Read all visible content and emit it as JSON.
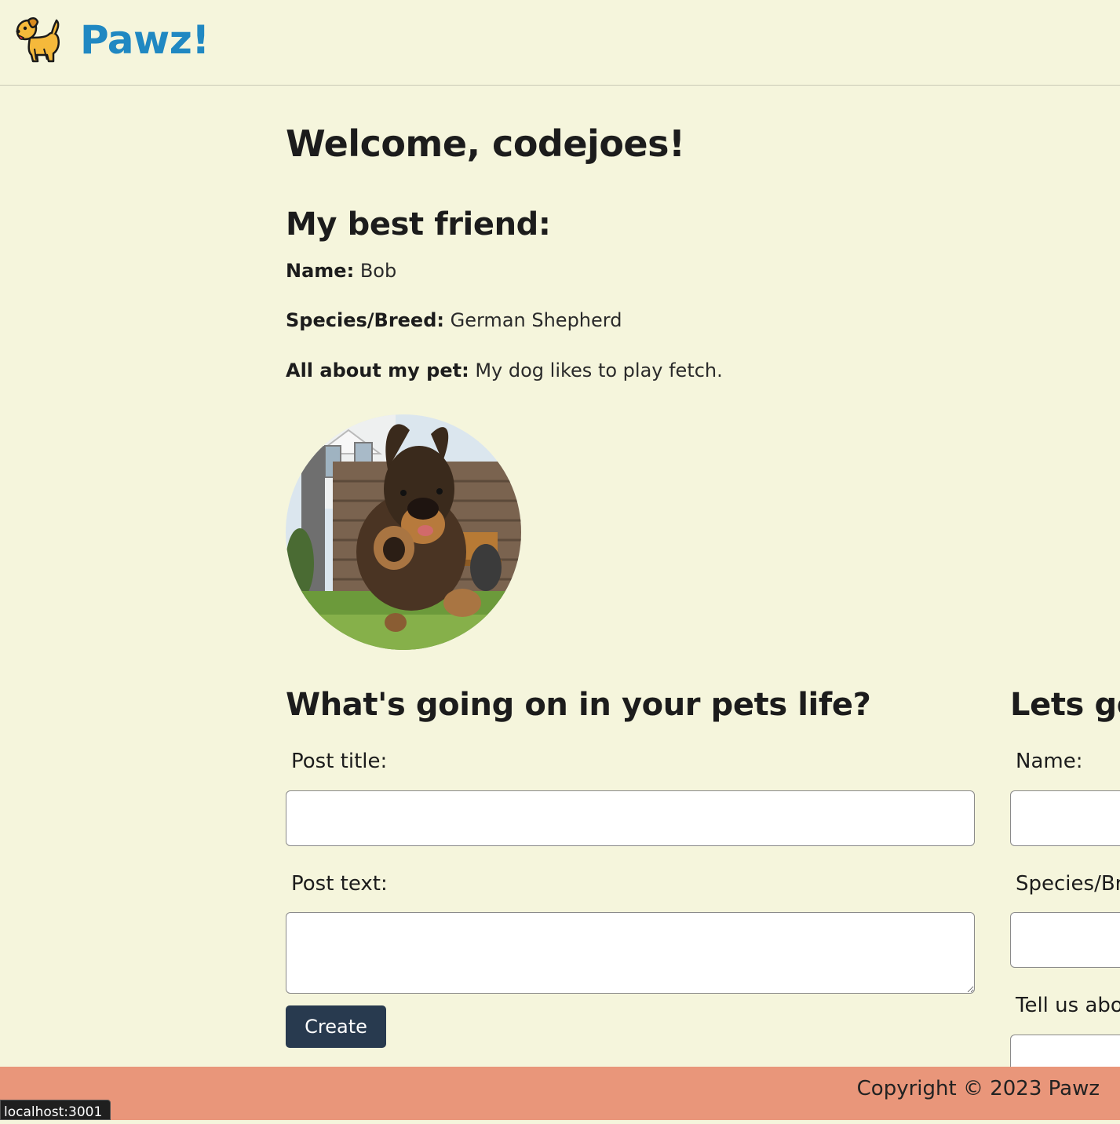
{
  "header": {
    "brand_name": "Pawz!",
    "logo_icon": "dog-icon"
  },
  "welcome": {
    "title": "Welcome, codejoes!"
  },
  "best_friend": {
    "heading": "My best friend:",
    "name_label": "Name:",
    "name_value": "Bob",
    "breed_label": "Species/Breed:",
    "breed_value": "German Shepherd",
    "about_label": "All about my pet:",
    "about_value": "My dog likes to play fetch."
  },
  "post_form": {
    "heading": "What's going on in your pets life?",
    "title_label": "Post title:",
    "title_value": "",
    "text_label": "Post text:",
    "text_value": "",
    "submit_label": "Create"
  },
  "pet_form": {
    "heading": "Lets ge",
    "name_label": "Name:",
    "breed_label": "Species/Br",
    "about_label": "Tell us abo"
  },
  "footer": {
    "copyright": "Copyright © 2023 Pawz"
  },
  "status_bar": {
    "url": "localhost:3001"
  },
  "colors": {
    "background": "#f5f5dc",
    "brand": "#2088c2",
    "button": "#283a4f",
    "footer": "#e9967a"
  }
}
